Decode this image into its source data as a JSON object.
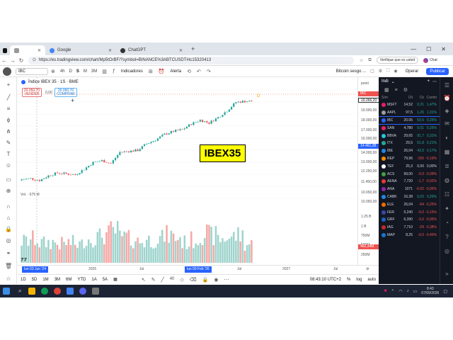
{
  "browser": {
    "tabs": [
      {
        "label": "",
        "active": false
      },
      {
        "label": "",
        "active": false
      },
      {
        "label": "Google",
        "active": false
      },
      {
        "label": "ChatGPT",
        "active": true
      }
    ],
    "url": "https://es.tradingview.com/chart/Mp5tOrBF/?symbol=BINANCE%3ABTCUSDT#tc15320413",
    "verify_label": "Verifique que es usted",
    "chat_label": "Chat"
  },
  "toolbar": {
    "symbol": "IBC",
    "timeframes": [
      "4h",
      "D",
      "S",
      "M",
      "3M"
    ],
    "selected_timeframe": "S",
    "indicators_label": "Indicadores",
    "alert_label": "Alerta",
    "watch_search_text": "Bitcoin sesgo ...",
    "operate_label": "Operar",
    "publish_label": "Publicar"
  },
  "chart": {
    "legend_title": "Índice IBEX 35 · 1S · BME",
    "sell_price": "20.050,70",
    "sell_label": "VENDER",
    "spread": "0,00",
    "buy_price": "20.050,70",
    "buy_label": "COMPRAR",
    "overlay_label": "IBEX35",
    "volume_label": "Vol. · 675 M",
    "price_ticks": [
      "19.000,00",
      "18.000,00",
      "17.000,00",
      "16.000,00",
      "15.000,00",
      "14.000,00",
      "13.800,00",
      "13.000,00",
      "12.250,00",
      "11.450,00",
      "10.650,00",
      "10.050,00",
      "9.450,00"
    ],
    "volume_ticks": [
      "1.25 B",
      "1 B",
      "750M",
      "500M",
      "250M"
    ],
    "price_axis_top": "point",
    "current_price_tag": "IBC",
    "current_price": "20.050,70",
    "second_price": "19.266,20",
    "mid_price": "14.461,38",
    "volume_value": "462,34M",
    "time_ticks": [
      "2025",
      "Jul",
      "2027",
      "Jul"
    ],
    "time_label_left": "lun 03 Jun '24",
    "time_label_mid": "lun 09 Feb '26",
    "chart_data": {
      "type": "candlestick",
      "title": "Índice IBEX 35 · 1S · BME",
      "x": [
        "2024-06",
        "2024-07",
        "2024-08",
        "2024-09",
        "2024-10",
        "2024-11",
        "2024-12",
        "2025-01",
        "2025-02",
        "2025-03",
        "2025-04",
        "2025-05",
        "2025-06",
        "2025-07",
        "2025-08",
        "2025-09",
        "2025-10",
        "2025-11",
        "2025-12",
        "2026-01",
        "2026-02",
        "2026-03",
        "2026-04",
        "2026-05",
        "2026-06",
        "2026-07"
      ],
      "close": [
        11000,
        11100,
        10900,
        11400,
        11700,
        11600,
        11500,
        12100,
        12800,
        13000,
        12700,
        13900,
        14000,
        14100,
        14800,
        15200,
        15800,
        16100,
        16300,
        16900,
        17300,
        17000,
        17600,
        18300,
        19200,
        19300
      ],
      "volume_millions": [
        550,
        600,
        500,
        520,
        480,
        510,
        470,
        600,
        650,
        720,
        800,
        650,
        600,
        540,
        580,
        620,
        700,
        640,
        520,
        580,
        750,
        690,
        610,
        660,
        700,
        470
      ],
      "ylim": [
        9450,
        20500
      ],
      "xlabel": "",
      "ylabel": ""
    }
  },
  "range_bar": {
    "ranges": [
      "1D",
      "5D",
      "1M",
      "3M",
      "6M",
      "YTD",
      "1A",
      "5A"
    ],
    "time": "08:43:10 UTC+2",
    "pct_label": "%",
    "log_label": "log",
    "auto_label": "auto"
  },
  "draw_toolbar": {
    "size": "40"
  },
  "watchlist": {
    "title": "Indi",
    "columns": {
      "symbol": "Sím",
      "last": "Últ",
      "change": "Cb",
      "change_pct": "Cambi"
    },
    "rows": [
      {
        "symbol": "MSFT",
        "last": "14,52",
        "chg": "0,21",
        "pct": "1,47%",
        "dir": "pos",
        "color": "#e91e63",
        "selected": false
      },
      {
        "symbol": "AAPL",
        "last": "97,5",
        "chg": "1,26",
        "pct": "1,31%",
        "dir": "pos",
        "color": "#9e9e9e",
        "selected": false
      },
      {
        "symbol": "IBC",
        "last": "20.05",
        "chg": "50,5",
        "pct": "0,25%",
        "dir": "pos",
        "color": "#2962ff",
        "selected": true
      },
      {
        "symbol": "SAN",
        "last": "4,780",
        "chg": "0,01",
        "pct": "0,25%",
        "dir": "pos",
        "color": "#e91e63",
        "selected": false
      },
      {
        "symbol": "BBVA",
        "last": "29,65",
        "chg": "91,7",
        "pct": "0,31%",
        "dir": "pos",
        "color": "#26c6da",
        "selected": false
      },
      {
        "symbol": "ITX",
        "last": "29,5",
        "chg": "61,8",
        "pct": "0,21%",
        "dir": "pos",
        "color": "#26a69a",
        "selected": false
      },
      {
        "symbol": "IBE",
        "last": "26,04",
        "chg": "43,0",
        "pct": "0,17%",
        "dir": "pos",
        "color": "#1e88e5",
        "selected": false
      },
      {
        "symbol": "REP",
        "last": "79,96",
        "chg": "-155",
        "pct": "-0,19%",
        "dir": "neg",
        "color": "#fb8c00",
        "selected": false
      },
      {
        "symbol": "TEF",
        "last": "25,3",
        "chg": "0,00",
        "pct": "0,00%",
        "dir": "zero",
        "color": "#ffffff",
        "selected": false
      },
      {
        "symbol": "ACS",
        "last": "99,00",
        "chg": "-0,0",
        "pct": "-0,09%",
        "dir": "neg",
        "color": "#43a047",
        "selected": false
      },
      {
        "symbol": "AENA",
        "last": "7,720",
        "chg": "-1,7",
        "pct": "-0,02%",
        "dir": "neg",
        "color": "#e53935",
        "selected": false
      },
      {
        "symbol": "ANA",
        "last": "1071",
        "chg": "-0,02",
        "pct": "-0,06%",
        "dir": "neg",
        "color": "#8e24aa",
        "selected": false
      },
      {
        "symbol": "CABK",
        "last": "16,38",
        "chg": "0,03",
        "pct": "0,20%",
        "dir": "pos",
        "color": "#1e88e5",
        "selected": false
      },
      {
        "symbol": "ELE",
        "last": "26,04",
        "chg": "-64",
        "pct": "-0,25%",
        "dir": "neg",
        "color": "#ef6c00",
        "selected": false
      },
      {
        "symbol": "FER",
        "last": "5,240",
        "chg": "-0,0",
        "pct": "-0,15%",
        "dir": "neg",
        "color": "#3949ab",
        "selected": false
      },
      {
        "symbol": "GRF",
        "last": "6,390",
        "chg": "-3,6",
        "pct": "-0,06%",
        "dir": "neg",
        "color": "#1565c0",
        "selected": false
      },
      {
        "symbol": "IAG",
        "last": "7,710",
        "chg": "-29",
        "pct": "-0,38%",
        "dir": "neg",
        "color": "#c62828",
        "selected": false
      },
      {
        "symbol": "MAP",
        "last": "8,25",
        "chg": "-0,0",
        "pct": "-0,40%",
        "dir": "neg",
        "color": "#1976d2",
        "selected": false
      }
    ]
  },
  "taskbar": {
    "time": "8:43",
    "date": "07/09/2026"
  }
}
